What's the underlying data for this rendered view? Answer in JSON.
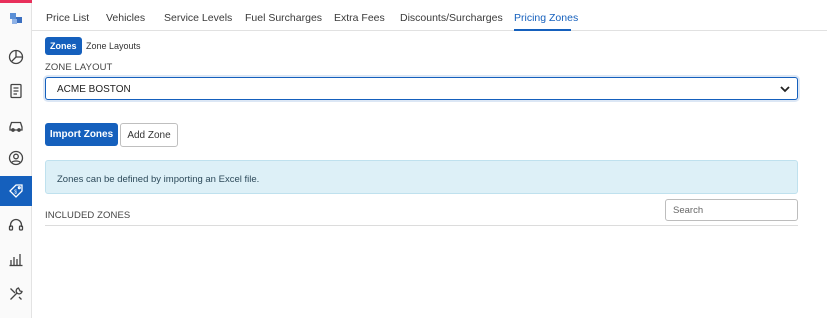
{
  "tabs": [
    {
      "label": "Price List",
      "active": false
    },
    {
      "label": "Vehicles",
      "active": false
    },
    {
      "label": "Service Levels",
      "active": false
    },
    {
      "label": "Fuel Surcharges",
      "active": false
    },
    {
      "label": "Extra Fees",
      "active": false
    },
    {
      "label": "Discounts/Surcharges",
      "active": false
    },
    {
      "label": "Pricing Zones",
      "active": true
    }
  ],
  "subtabs": {
    "zones": "Zones",
    "zone_layouts": "Zone Layouts"
  },
  "zone_layout": {
    "label": "ZONE LAYOUT",
    "selected": "ACME BOSTON"
  },
  "buttons": {
    "import": "Import Zones",
    "add": "Add Zone"
  },
  "info_message": "Zones can be defined by importing an Excel file.",
  "included_zones": {
    "label": "INCLUDED ZONES",
    "search_placeholder": "Search"
  },
  "sidebar": {
    "items": [
      {
        "icon": "logo-icon",
        "active": false
      },
      {
        "icon": "pie-chart-icon",
        "active": false
      },
      {
        "icon": "document-icon",
        "active": false
      },
      {
        "icon": "car-icon",
        "active": false
      },
      {
        "icon": "user-circle-icon",
        "active": false
      },
      {
        "icon": "price-tag-icon",
        "active": true
      },
      {
        "icon": "headset-icon",
        "active": false
      },
      {
        "icon": "chart-hand-icon",
        "active": false
      },
      {
        "icon": "tools-icon",
        "active": false
      }
    ]
  },
  "colors": {
    "primary": "#1560bd",
    "accent": "#e8305b",
    "info_bg": "#ddf0f7"
  }
}
